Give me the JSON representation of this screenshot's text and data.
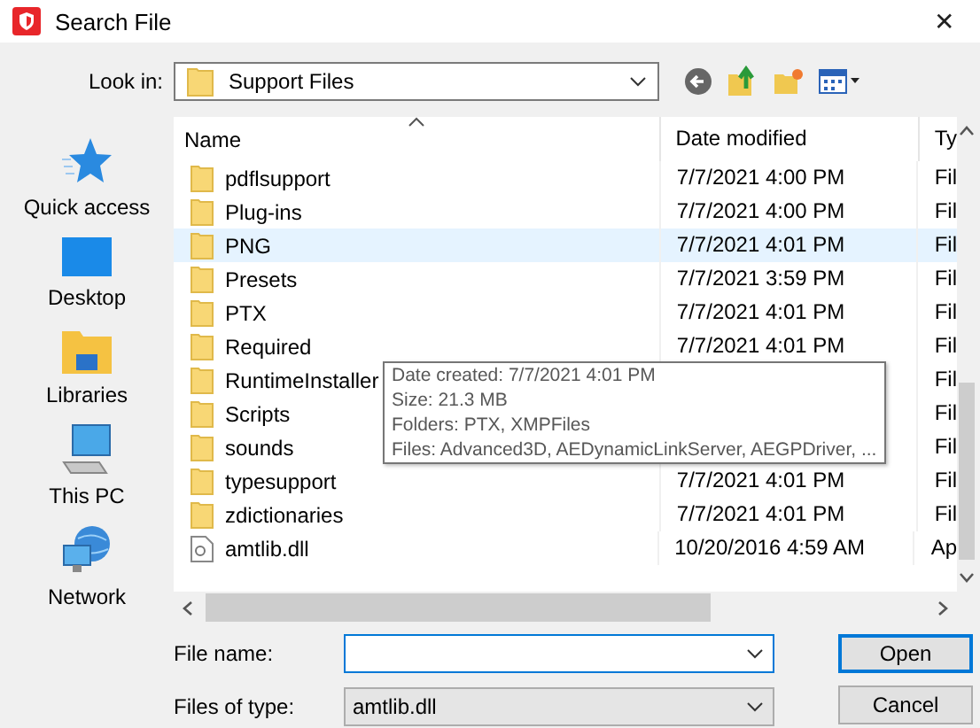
{
  "window": {
    "title": "Search File",
    "close": "✕"
  },
  "look_in": {
    "label": "Look in:",
    "value": "Support Files"
  },
  "places": [
    {
      "label": "Quick access",
      "kind": "star"
    },
    {
      "label": "Desktop",
      "kind": "desktop"
    },
    {
      "label": "Libraries",
      "kind": "libraries"
    },
    {
      "label": "This PC",
      "kind": "pc"
    },
    {
      "label": "Network",
      "kind": "network"
    }
  ],
  "columns": [
    "Name",
    "Date modified",
    "Ty"
  ],
  "rows": [
    {
      "name": "pdflsupport",
      "date": "7/7/2021 4:00 PM",
      "type": "Fil",
      "kind": "folder",
      "selected": false
    },
    {
      "name": "Plug-ins",
      "date": "7/7/2021 4:00 PM",
      "type": "Fil",
      "kind": "folder",
      "selected": false
    },
    {
      "name": "PNG",
      "date": "7/7/2021 4:01 PM",
      "type": "Fil",
      "kind": "folder",
      "selected": true
    },
    {
      "name": "Presets",
      "date": "7/7/2021 3:59 PM",
      "type": "Fil",
      "kind": "folder",
      "selected": false
    },
    {
      "name": "PTX",
      "date": "7/7/2021 4:01 PM",
      "type": "Fil",
      "kind": "folder",
      "selected": false
    },
    {
      "name": "Required",
      "date": "7/7/2021 4:01 PM",
      "type": "Fil",
      "kind": "folder",
      "selected": false
    },
    {
      "name": "RuntimeInstaller",
      "type": "Fil",
      "kind": "folder",
      "selected": false
    },
    {
      "name": "Scripts",
      "type": "Fil",
      "kind": "folder",
      "selected": false
    },
    {
      "name": "sounds",
      "type": "Fil",
      "kind": "folder",
      "selected": false
    },
    {
      "name": "typesupport",
      "date": "7/7/2021 4:01 PM",
      "type": "Fil",
      "kind": "folder",
      "selected": false
    },
    {
      "name": "zdictionaries",
      "date": "7/7/2021 4:01 PM",
      "type": "Fil",
      "kind": "folder",
      "selected": false
    },
    {
      "name": "amtlib.dll",
      "date": "10/20/2016 4:59 AM",
      "type": "Ap",
      "kind": "file",
      "selected": false
    }
  ],
  "tooltip": [
    "Date created: 7/7/2021 4:01 PM",
    "Size: 21.3 MB",
    "Folders: PTX, XMPFiles",
    "Files: Advanced3D, AEDynamicLinkServer, AEGPDriver, ..."
  ],
  "file_name": {
    "label": "File name:"
  },
  "file_type": {
    "label": "Files of type:",
    "value": "amtlib.dll"
  },
  "buttons": [
    "Open",
    "Cancel"
  ]
}
